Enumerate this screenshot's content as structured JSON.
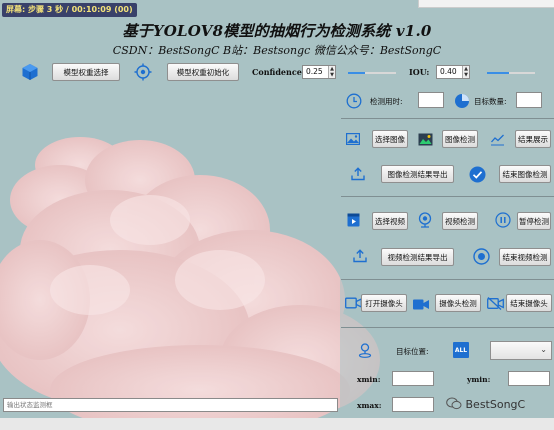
{
  "recorder": {
    "text": "屏幕: 步骤 3 秒 / 00:10:09 (00)"
  },
  "header": {
    "title": "基于YOLOV8模型的抽烟行为检测系统 v1.0",
    "subtitle": "CSDN：BestSongC   B站：Bestsongc   微信公众号：BestSongC"
  },
  "toolbar": {
    "model_select_label": "模型权重选择",
    "model_init_label": "模型权重初始化",
    "confidence_label": "Confidence:",
    "confidence_value": "0.25",
    "confidence_fraction": 0.35,
    "iou_label": "IOU:",
    "iou_value": "0.40",
    "iou_fraction": 0.45
  },
  "stats": {
    "time_label": "检测用时:",
    "count_label": "目标数量:"
  },
  "image_section": {
    "select_label": "选择图像",
    "detect_label": "图像检测",
    "result_label": "结果展示",
    "export_label": "图像检测结果导出",
    "end_label": "结束图像检测"
  },
  "video_section": {
    "select_label": "选择视频",
    "detect_label": "视频检测",
    "pause_label": "暂停检测",
    "export_label": "视频检测结果导出",
    "end_label": "结束视频检测"
  },
  "camera_section": {
    "open_label": "打开摄像头",
    "detect_label": "摄像头检测",
    "end_label": "结束摄像头"
  },
  "target_section": {
    "position_label": "目标位置:",
    "all_label": "ALL",
    "xmin_label": "xmin:",
    "ymin_label": "ymin:",
    "xmax_label": "xmax:"
  },
  "status_bar": {
    "placeholder": "输出状态监测框"
  },
  "watermark": {
    "text": "BestSongC"
  },
  "colors": {
    "accent": "#1e6fd0",
    "background": "#a9c2c4",
    "cloud": "#f2cfcf"
  }
}
